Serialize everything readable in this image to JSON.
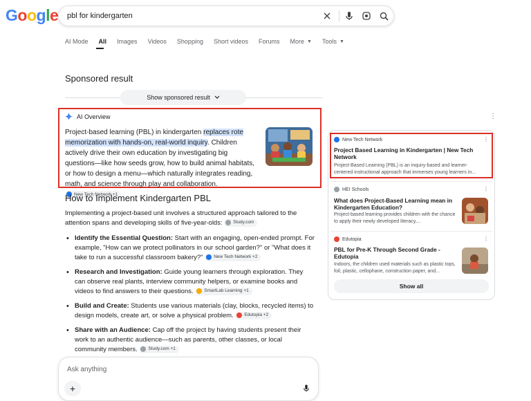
{
  "header": {
    "logo": "Google",
    "search_query": "pbl for kindergarten"
  },
  "tabs": [
    {
      "label": "AI Mode"
    },
    {
      "label": "All"
    },
    {
      "label": "Images"
    },
    {
      "label": "Videos"
    },
    {
      "label": "Shopping"
    },
    {
      "label": "Short videos"
    },
    {
      "label": "Forums"
    },
    {
      "label": "More"
    },
    {
      "label": "Tools"
    }
  ],
  "sponsored": {
    "title": "Sponsored result",
    "show_button": "Show sponsored result"
  },
  "ai_overview": {
    "label": "AI Overview",
    "text_before": "Project-based learning (PBL) in kindergarten ",
    "text_highlight": "replaces rote memorization with hands-on, real-world inquiry",
    "text_after": ". Children actively drive their own education by investigating big questions—like how seeds grow, how to build animal habitats, or how to design a menu—which naturally integrates reading, math, and science through play and collaboration.",
    "chip": "New Tech Network +1"
  },
  "howto": {
    "heading": "How to Implement Kindergarten PBL",
    "intro": "Implementing a project-based unit involves a structured approach tailored to the attention spans and developing skills of five-year-olds:",
    "intro_chip": "Study.com",
    "bullets": [
      {
        "bold": "Identify the Essential Question:",
        "text": " Start with an engaging, open-ended prompt. For example, \"How can we protect pollinators in our school garden?\" or \"What does it take to run a successful classroom bakery?\"",
        "chip": "New Tech Network +2"
      },
      {
        "bold": "Research and Investigation:",
        "text": " Guide young learners through exploration. They can observe real plants, interview community helpers, or examine books and videos to find answers to their questions.",
        "chip": "SmartLab Learning +1"
      },
      {
        "bold": "Build and Create:",
        "text": " Students use various materials (clay, blocks, recycled items) to design models, create art, or solve a physical problem.",
        "chip": "Edutopia +2"
      },
      {
        "bold": "Share with an Audience:",
        "text": " Cap off the project by having students present their work to an authentic audience—such as parents, other classes, or local community members.",
        "chip": "Study.com +1"
      }
    ]
  },
  "ask": {
    "placeholder": "Ask anything"
  },
  "sources": [
    {
      "site": "New Tech Network",
      "title": "Project Based Learning in Kindergarten | New Tech Network",
      "snippet": "Project-Based Learning (PBL) is an inquiry-based and learner-centered instructional approach that immerses young learners in...",
      "color": "#1a73e8"
    },
    {
      "site": "HEI Schools",
      "title": "What does Project-Based Learning mean in Kindergarten Education?",
      "snippet": "Project-based learning provides children with the chance to apply their newly developed literacy,...",
      "color": "#9aa0a6"
    },
    {
      "site": "Edutopia",
      "title": "PBL for Pre-K Through Second Grade - Edutopia",
      "snippet": "Indoors, the children used materials such as plastic tops, foil, plastic, cellophane, construction paper, and...",
      "color": "#ea4335"
    }
  ],
  "show_all": "Show all",
  "colors": {
    "accent": "#1a73e8",
    "highlight": "#d3e3fd",
    "red_box": "#d93025"
  }
}
